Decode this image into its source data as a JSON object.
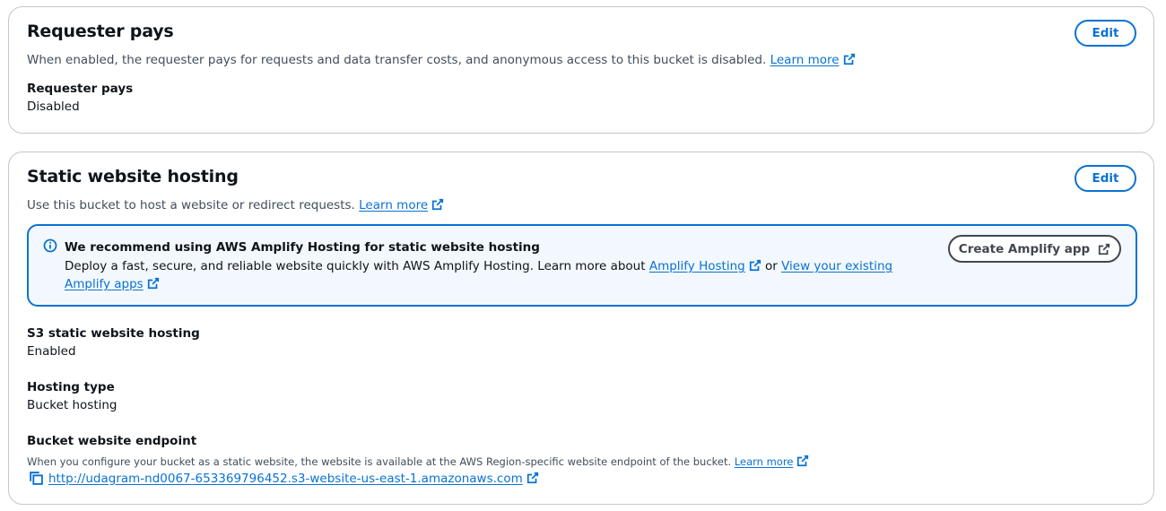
{
  "requester_pays": {
    "title": "Requester pays",
    "edit_label": "Edit",
    "description": "When enabled, the requester pays for requests and data transfer costs, and anonymous access to this bucket is disabled.",
    "learn_more": "Learn more",
    "field_label": "Requester pays",
    "field_value": "Disabled"
  },
  "static_hosting": {
    "title": "Static website hosting",
    "edit_label": "Edit",
    "description": "Use this bucket to host a website or redirect requests.",
    "learn_more": "Learn more",
    "alert": {
      "title": "We recommend using AWS Amplify Hosting for static website hosting",
      "text_prefix": "Deploy a fast, secure, and reliable website quickly with AWS Amplify Hosting. Learn more about",
      "link1": "Amplify Hosting",
      "text_mid": "or",
      "link2": "View your existing Amplify apps",
      "button_label": "Create Amplify app"
    },
    "fields": {
      "s3_label": "S3 static website hosting",
      "s3_value": "Enabled",
      "type_label": "Hosting type",
      "type_value": "Bucket hosting",
      "endpoint_label": "Bucket website endpoint",
      "endpoint_desc": "When you configure your bucket as a static website, the website is available at the AWS Region-specific website endpoint of the bucket.",
      "endpoint_learn_more": "Learn more",
      "endpoint_url": "http://udagram-nd0067-653369796452.s3-website-us-east-1.amazonaws.com"
    }
  },
  "colors": {
    "link": "#0972d3",
    "info_bg": "#f2f8fd",
    "border": "#c6c6cd",
    "text": "#0f141a"
  },
  "icons": [
    "external-link-icon",
    "info-icon",
    "copy-icon"
  ]
}
